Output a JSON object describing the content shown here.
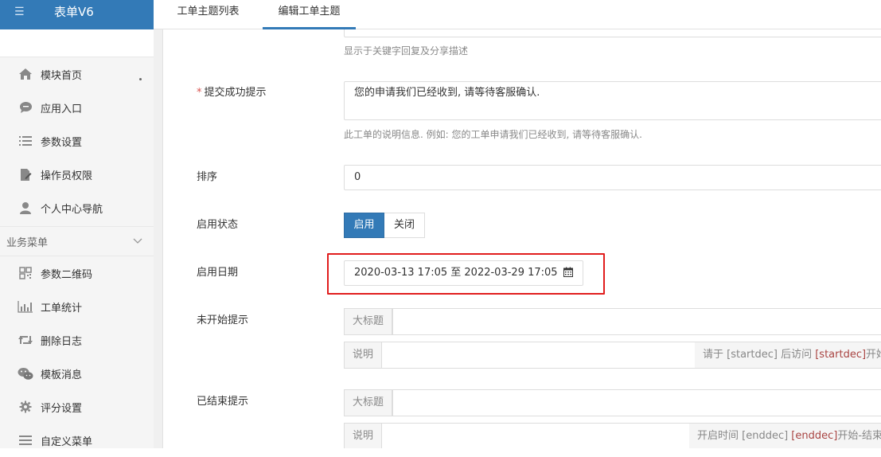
{
  "app": {
    "title": "表单V6"
  },
  "tabs": [
    {
      "label": "工单主题列表",
      "active": false
    },
    {
      "label": "编辑工单主题",
      "active": true
    }
  ],
  "sidebar": {
    "items": [
      {
        "label": "模块首页",
        "icon": "home-icon"
      },
      {
        "label": "应用入口",
        "icon": "chat-icon"
      },
      {
        "label": "参数设置",
        "icon": "list-icon"
      },
      {
        "label": "操作员权限",
        "icon": "doc-edit-icon"
      },
      {
        "label": "个人中心导航",
        "icon": "user-icon"
      }
    ],
    "section": {
      "label": "业务菜单"
    },
    "business_items": [
      {
        "label": "参数二维码",
        "icon": "qrcode-icon"
      },
      {
        "label": "工单统计",
        "icon": "bar-chart-icon"
      },
      {
        "label": "删除日志",
        "icon": "retweet-icon"
      },
      {
        "label": "模板消息",
        "icon": "wechat-icon"
      },
      {
        "label": "评分设置",
        "icon": "gear-icon"
      },
      {
        "label": "自定义菜单",
        "icon": "menu-icon"
      }
    ]
  },
  "form": {
    "share_desc_help": "显示于关键字回复及分享描述",
    "success_tip": {
      "label": "提交成功提示",
      "required_mark": "*",
      "value": "您的申请我们已经收到, 请等待客服确认.",
      "help": "此工单的说明信息. 例如: 您的工单申请我们已经收到, 请等待客服确认."
    },
    "sort": {
      "label": "排序",
      "value": "0"
    },
    "status": {
      "label": "启用状态",
      "on_label": "启用",
      "off_label": "关闭",
      "selected": "启用"
    },
    "date_range": {
      "label": "启用日期",
      "value": "2020-03-13 17:05 至 2022-03-29 17:05"
    },
    "not_started": {
      "label": "未开始提示",
      "title_addon": "大标题",
      "desc_addon": "说明",
      "hint_prefix": "请于 [startdec] 后访问 ",
      "hint_tag": "[startdec]",
      "hint_suffix": "开始"
    },
    "ended": {
      "label": "已结束提示",
      "title_addon": "大标题",
      "desc_addon": "说明",
      "hint_prefix": "开启时间 [enddec] ",
      "hint_tag": "[enddec]",
      "hint_suffix": "开始-结束"
    }
  },
  "colors": {
    "accent": "#337ab7",
    "highlight": "#e11d1d",
    "tag": "#a94442"
  }
}
